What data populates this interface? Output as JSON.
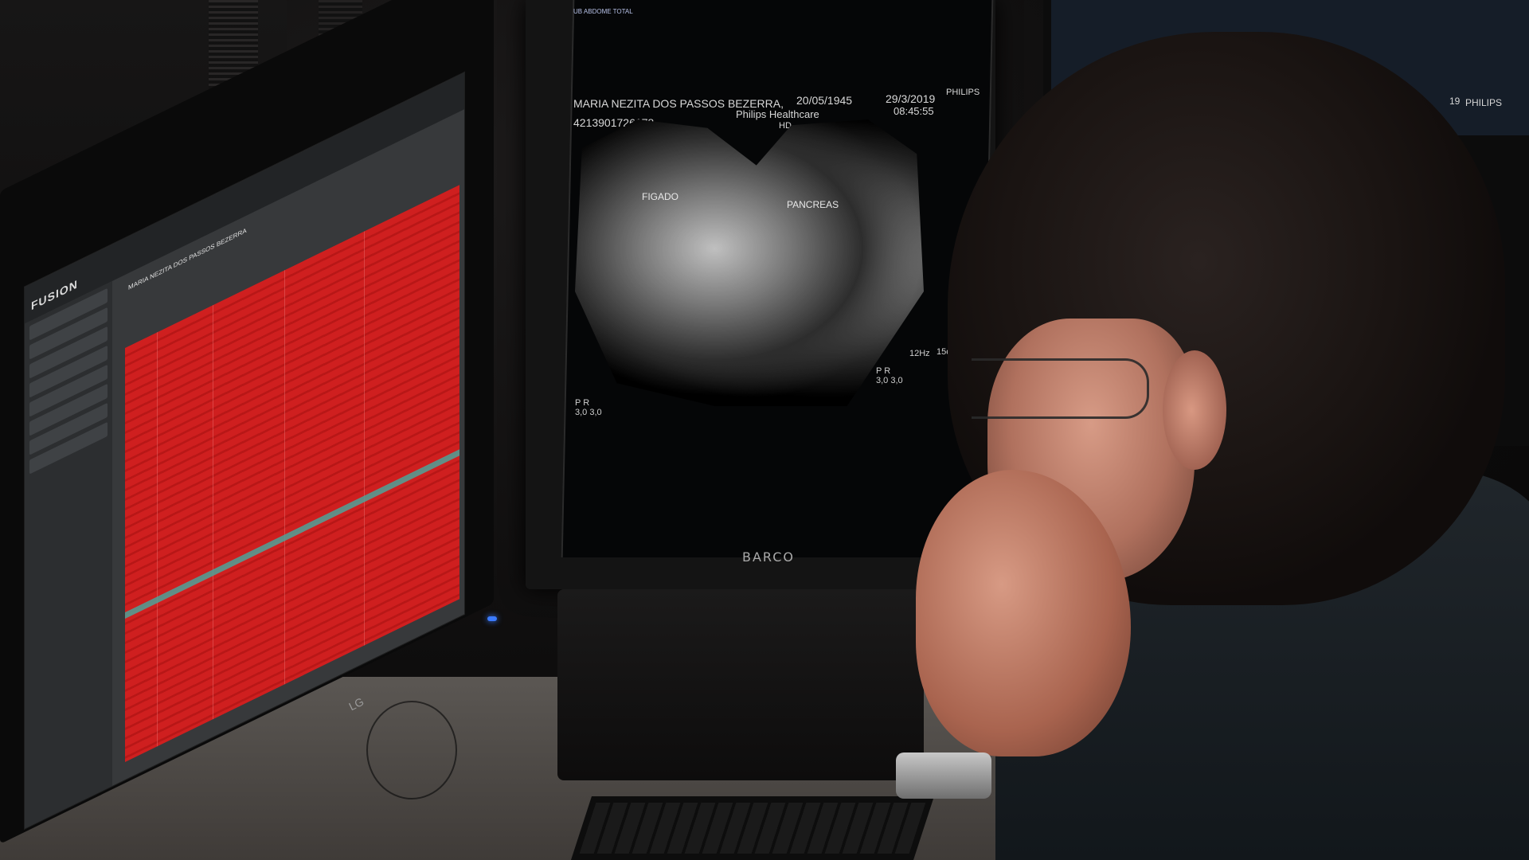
{
  "scene": {
    "description_key": "photo",
    "lg_monitor": {
      "brand_label": "FUSION",
      "monitor_brand": "LG",
      "table_color": "#cf1f1f",
      "highlight_color": "#4fa39a",
      "info_text": "MARIA NEZITA DOS PASSOS BEZERRA"
    },
    "barco_monitor": {
      "brand_label": "BARCO",
      "header_left_line1": "MARIA NEZITA DOS PASSOS BEZERRA,",
      "header_id": "4213901726178",
      "header_dob": "20/05/1945",
      "header_date": "29/3/2019",
      "header_time": "08:45:55",
      "header_vendor": "PHILIPS",
      "header_subvendor": "Philips Healthcare",
      "probe_label": "HD",
      "organ_left": "FIGADO",
      "organ_right": "PANCREAS",
      "freq_label": "12Hz",
      "depth_label": "15cm",
      "marker_left": "P R\n3,0 3,0",
      "marker_right": "P R\n3,0 3,0",
      "tiny_top_1": "UB ABDOME TOTAL"
    },
    "right_monitor": {
      "header_top": "19",
      "vendor": "PHILIPS"
    }
  }
}
